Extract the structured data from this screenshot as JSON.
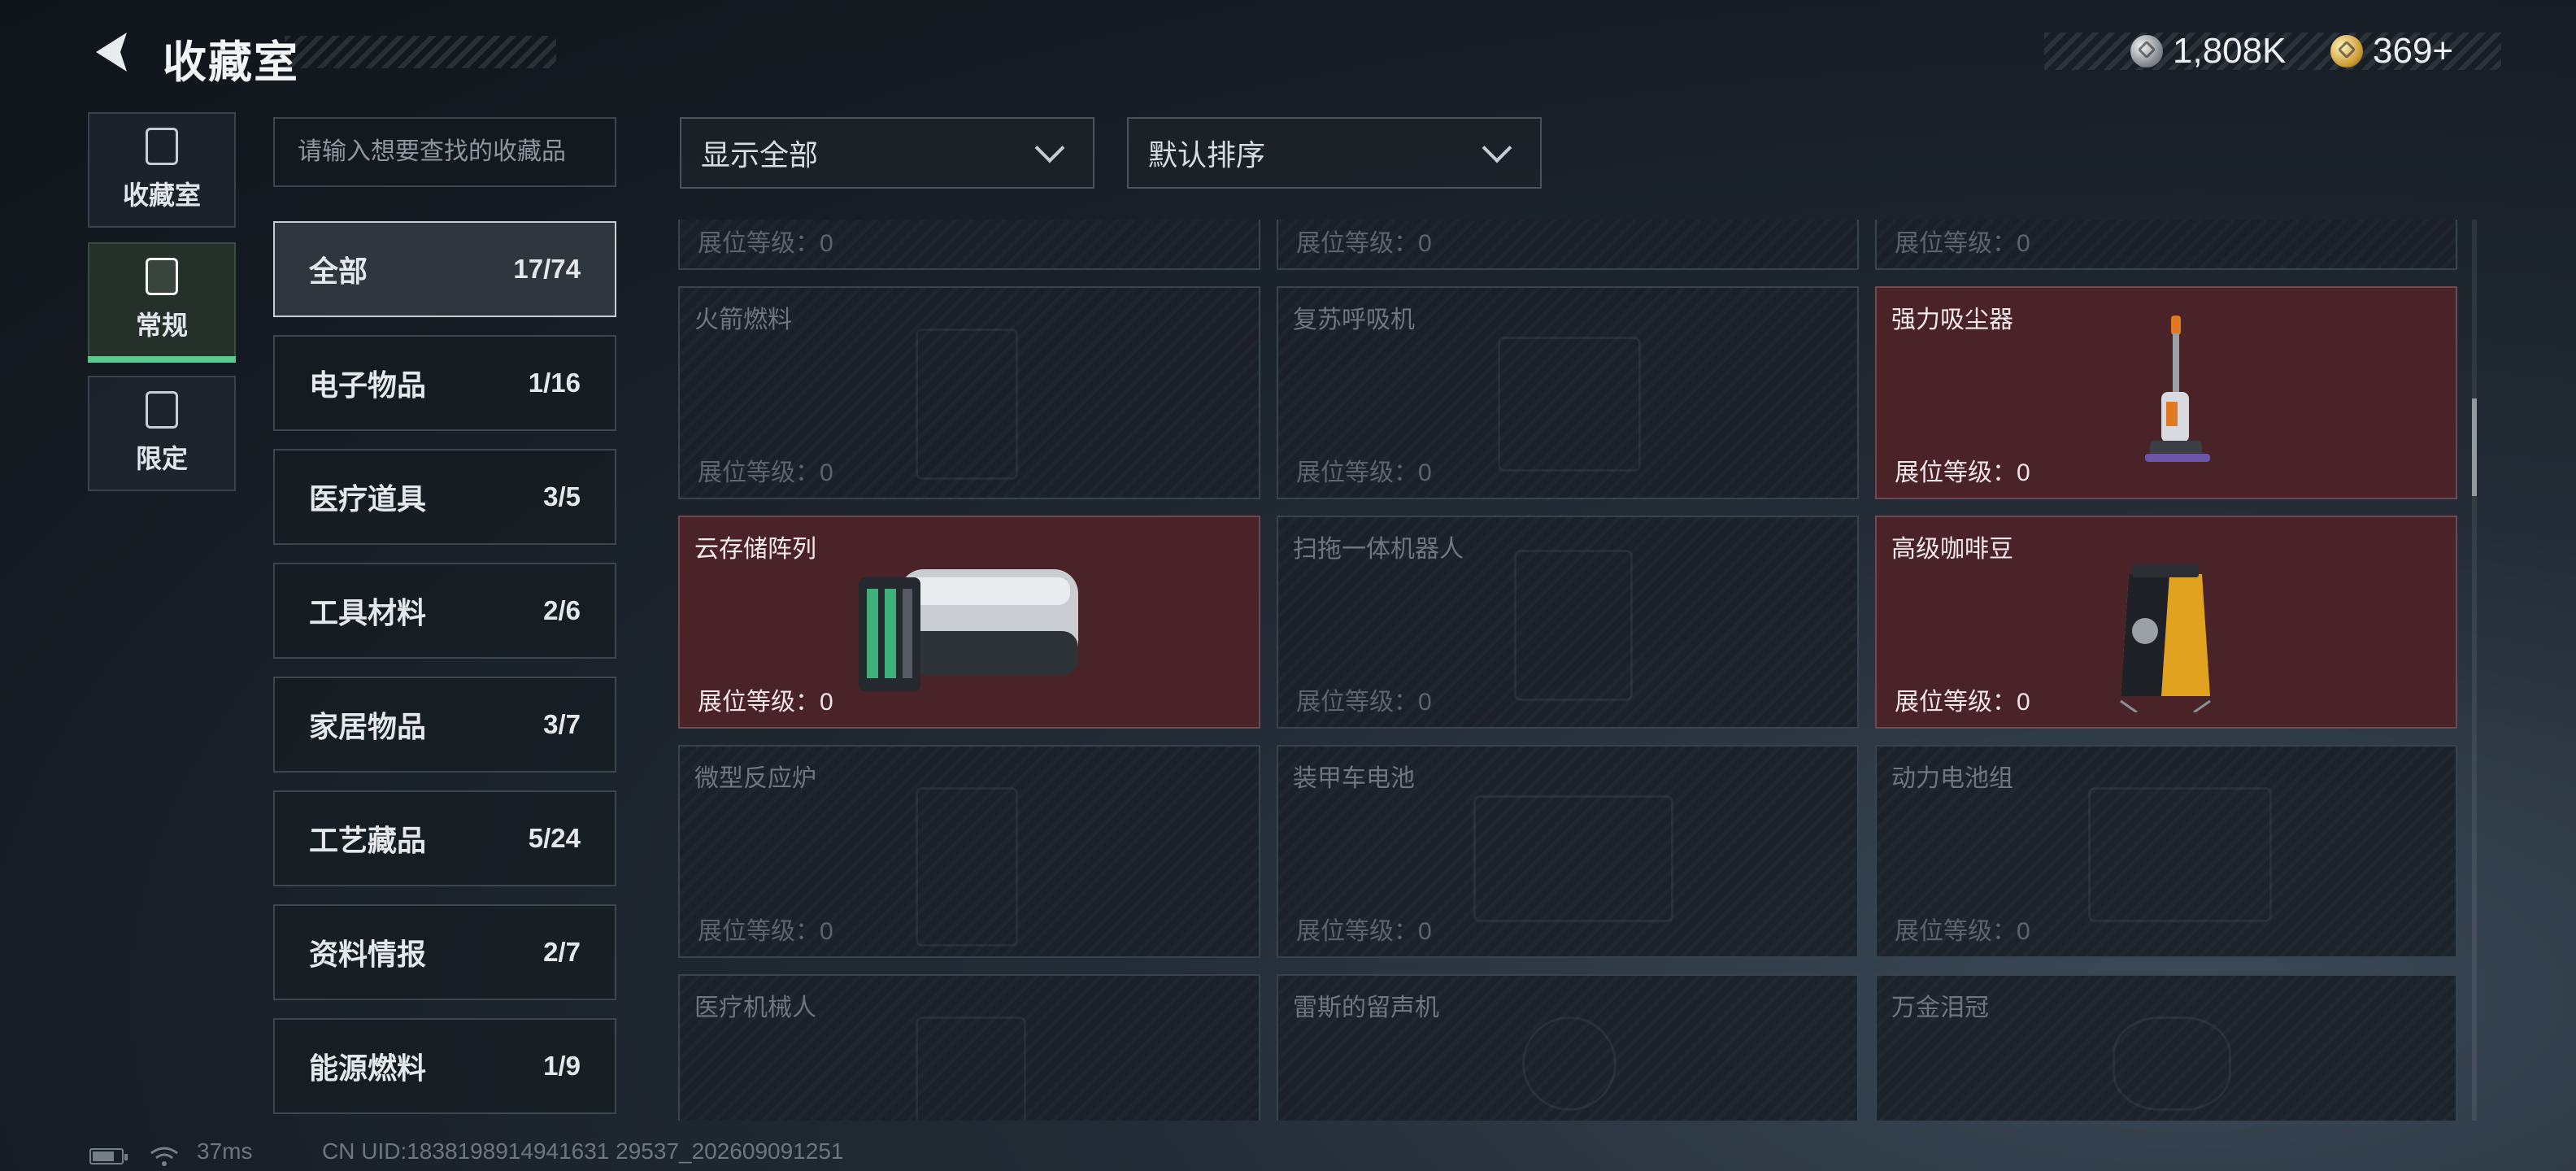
{
  "header": {
    "title": "收藏室"
  },
  "currency": [
    {
      "icon": "silver-coin-icon",
      "value": "1,808K"
    },
    {
      "icon": "gold-coin-icon",
      "value": "369+"
    }
  ],
  "nav": [
    {
      "label": "收藏室",
      "icon": "collection-room-icon",
      "active": false
    },
    {
      "label": "常规",
      "icon": "regular-icon",
      "active": true
    },
    {
      "label": "限定",
      "icon": "limited-icon",
      "active": false
    }
  ],
  "search": {
    "placeholder": "请输入想要查找的收藏品"
  },
  "categories": [
    {
      "name": "全部",
      "count": "17/74",
      "active": true
    },
    {
      "name": "电子物品",
      "count": "1/16"
    },
    {
      "name": "医疗道具",
      "count": "3/5"
    },
    {
      "name": "工具材料",
      "count": "2/6"
    },
    {
      "name": "家居物品",
      "count": "3/7"
    },
    {
      "name": "工艺藏品",
      "count": "5/24"
    },
    {
      "name": "资料情报",
      "count": "2/7"
    },
    {
      "name": "能源燃料",
      "count": "1/9"
    }
  ],
  "filters": {
    "display": "显示全部",
    "sort": "默认排序"
  },
  "level_label": "展位等级：",
  "items": [
    {
      "name": "",
      "level": "0",
      "owned": false
    },
    {
      "name": "",
      "level": "0",
      "owned": false
    },
    {
      "name": "",
      "level": "0",
      "owned": false
    },
    {
      "name": "火箭燃料",
      "level": "0",
      "owned": false
    },
    {
      "name": "复苏呼吸机",
      "level": "0",
      "owned": false
    },
    {
      "name": "强力吸尘器",
      "level": "0",
      "owned": true
    },
    {
      "name": "云存储阵列",
      "level": "0",
      "owned": true
    },
    {
      "name": "扫拖一体机器人",
      "level": "0",
      "owned": false
    },
    {
      "name": "高级咖啡豆",
      "level": "0",
      "owned": true
    },
    {
      "name": "微型反应炉",
      "level": "0",
      "owned": false
    },
    {
      "name": "装甲车电池",
      "level": "0",
      "owned": false
    },
    {
      "name": "动力电池组",
      "level": "0",
      "owned": false
    },
    {
      "name": "医疗机械人",
      "level": "",
      "owned": false
    },
    {
      "name": "雷斯的留声机",
      "level": "",
      "owned": false
    },
    {
      "name": "万金泪冠",
      "level": "",
      "owned": false
    }
  ],
  "footer": {
    "ping": "37ms",
    "uid": "CN UID:1838198914941631 29537_202609091251"
  },
  "colors": {
    "accent": "#58c98f",
    "owned_bg": "#4a2329"
  }
}
